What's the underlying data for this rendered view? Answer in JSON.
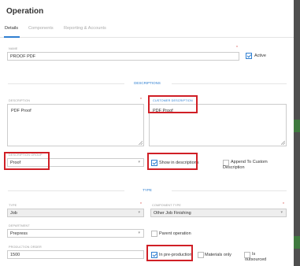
{
  "window": {
    "title": "Operation"
  },
  "tabs": [
    {
      "label": "Details"
    },
    {
      "label": "Components"
    },
    {
      "label": "Reporting & Accounts"
    }
  ],
  "form": {
    "name": {
      "label": "NAME",
      "value": "PROOF PDF",
      "required_mark": "*"
    },
    "active": {
      "label": "Active",
      "checked": true
    },
    "sections": {
      "descriptions": "DESCRIPTIONS",
      "type": "TYPE"
    },
    "description": {
      "label": "DESCRIPTION",
      "value": "PDF Proof",
      "required_mark": "*"
    },
    "customer_description": {
      "label": "CUSTOMER DESCRIPTION",
      "value": "PDF Proof"
    },
    "description_group": {
      "label": "DESCRIPTION GROUP",
      "value": "Proof",
      "caret": "▾"
    },
    "show_in_descriptions": {
      "label": "Show in descriptions",
      "checked": true
    },
    "append_to_custom": {
      "label_line1": "Append To Custom",
      "label_line2": "Description",
      "checked": false
    },
    "type": {
      "label": "TYPE",
      "value": "Job",
      "required_mark": "*",
      "caret": "▾"
    },
    "component_type": {
      "label": "COMPONENT TYPE",
      "value": "Other Job Finishing",
      "required_mark": "*",
      "caret": "▾"
    },
    "department": {
      "label": "DEPARTMENT",
      "value": "Prepress",
      "caret": "▾"
    },
    "parent_operation": {
      "label": "Parent operation",
      "checked": false
    },
    "production_order": {
      "label": "PRODUCTION ORDER",
      "value": "1500"
    },
    "in_pre_production": {
      "label": "In pre-production",
      "checked": true
    },
    "materials_only": {
      "label": "Materials only",
      "checked": false
    },
    "is_outsourced": {
      "label_line1": "Is",
      "label_line2": "outsourced",
      "checked": false
    }
  },
  "colors": {
    "accent": "#2f7fd1",
    "highlight": "#d01f26",
    "required": "#d9534f"
  }
}
